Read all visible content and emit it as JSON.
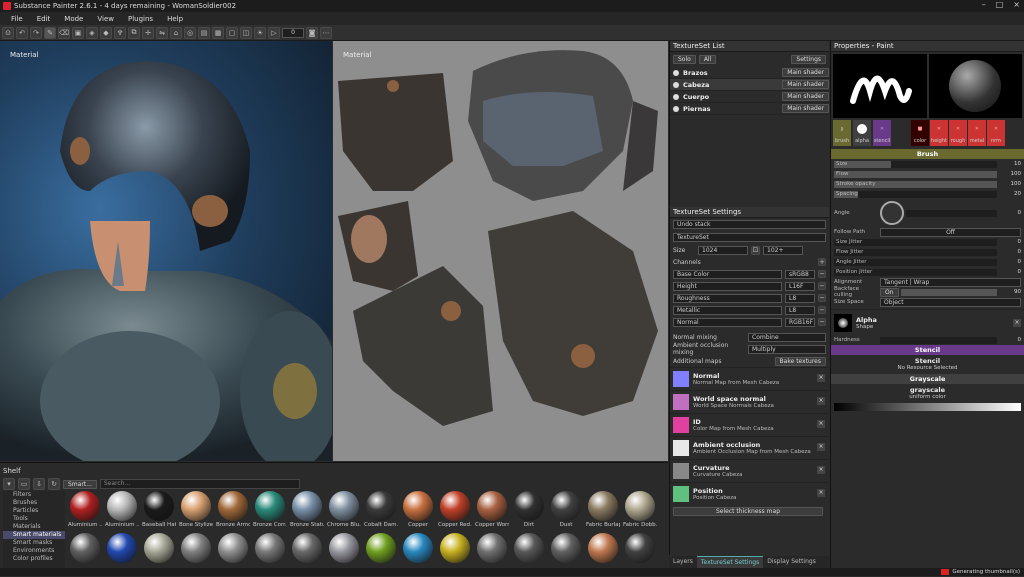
{
  "window": {
    "title": "Substance Painter 2.6.1 - 4 days remaining - WomanSoldier002"
  },
  "menu": [
    "File",
    "Edit",
    "Mode",
    "View",
    "Plugins",
    "Help"
  ],
  "toolbar": {
    "value": "0"
  },
  "viewport3d": {
    "label": "Material"
  },
  "viewport2d": {
    "label": "Material"
  },
  "shelf": {
    "title": "Shelf",
    "tab": "Smart...",
    "search_placeholder": "Search...",
    "categories": [
      "Filters",
      "Brushes",
      "Particles",
      "Tools",
      "Materials",
      "Smart materials",
      "Smart masks",
      "Environments",
      "Color profiles"
    ],
    "selected_category": "Smart materials",
    "materials_row1": [
      "Aluminium ...",
      "Aluminium ...",
      "Baseball Hat...",
      "Bone Stylized",
      "Bronze Armor",
      "Bronze Corr...",
      "Bronze Statue",
      "Chrome Blu...",
      "Cobalt Dam...",
      "Copper",
      "Copper Red...",
      "Copper Worn",
      "Dirt",
      "Dust",
      "Fabric Burlap",
      "Fabric Dobb..."
    ],
    "materials_row1_colors": [
      "#b02020",
      "#b8b8b8",
      "#1a1a1a",
      "#d8a070",
      "#a06838",
      "#2a8a7a",
      "#7890a8",
      "#8090a0",
      "#3a3a3a",
      "#c87040",
      "#c04028",
      "#a86040",
      "#303030",
      "#404040",
      "#8a7a60",
      "#b0a890"
    ],
    "materials_row2_colors": [
      "#606060",
      "#2048b0",
      "#a8a898",
      "#808080",
      "#909090",
      "#787878",
      "#686868",
      "#9898a0",
      "#70a020",
      "#2888c0",
      "#c8b020",
      "#707070",
      "#585858",
      "#606060",
      "#c07850",
      "#404040"
    ]
  },
  "textureset_list": {
    "title": "TextureSet List",
    "solo": "Solo",
    "all": "All",
    "settings": "Settings",
    "items": [
      {
        "name": "Brazos",
        "shader": "Main shader"
      },
      {
        "name": "Cabeza",
        "shader": "Main shader"
      },
      {
        "name": "Cuerpo",
        "shader": "Main shader"
      },
      {
        "name": "Piernas",
        "shader": "Main shader"
      }
    ]
  },
  "textureset_settings": {
    "title": "TextureSet Settings",
    "undo_stack": "Undo stack",
    "textureset": "TextureSet",
    "size_label": "Size",
    "size_value": "1024",
    "size_value2": "102+",
    "channels_label": "Channels",
    "channels": [
      {
        "name": "Base Color",
        "format": "sRGB8"
      },
      {
        "name": "Height",
        "format": "L16F"
      },
      {
        "name": "Roughness",
        "format": "L8"
      },
      {
        "name": "Metallic",
        "format": "L8"
      },
      {
        "name": "Normal",
        "format": "RGB16F"
      }
    ],
    "normal_mixing_label": "Normal mixing",
    "normal_mixing_value": "Combine",
    "ao_mixing_label": "Ambient occlusion mixing",
    "ao_mixing_value": "Multiply",
    "additional_maps": "Additional maps",
    "bake_textures": "Bake textures",
    "maps": [
      {
        "name": "Normal",
        "sub": "Normal Map from Mesh Cabeza",
        "color": "#8080ff"
      },
      {
        "name": "World space normal",
        "sub": "World Space Normals Cabeza",
        "color": "#c070c0"
      },
      {
        "name": "ID",
        "sub": "Color Map from Mesh Cabeza",
        "color": "#e040a0"
      },
      {
        "name": "Ambient occlusion",
        "sub": "Ambient Occlusion Map from Mesh Cabeza",
        "color": "#e8e8e8"
      },
      {
        "name": "Curvature",
        "sub": "Curvature Cabeza",
        "color": "#888888"
      },
      {
        "name": "Position",
        "sub": "Position Cabeza",
        "color": "#60c080"
      }
    ],
    "select_thickness": "Select thickness map"
  },
  "bottom_tabs": [
    "Layers",
    "TextureSet Settings",
    "Display Settings"
  ],
  "properties": {
    "title": "Properties - Paint",
    "slots": [
      "brush",
      "alpha",
      "stencil"
    ],
    "material_slots": [
      "color",
      "height",
      "rough",
      "metal",
      "nrm"
    ],
    "brush_section": "Brush",
    "rows": [
      {
        "label": "Size",
        "value": "10",
        "fill": 0.35
      },
      {
        "label": "Flow",
        "value": "100",
        "fill": 1.0
      },
      {
        "label": "Stroke opacity",
        "value": "100",
        "fill": 1.0
      },
      {
        "label": "Spacing",
        "value": "20",
        "fill": 0.15
      }
    ],
    "angle_label": "Angle",
    "angle_value": "0",
    "follow_path": "Follow Path",
    "follow_path_value": "Off",
    "jitters": [
      {
        "label": "Size Jitter",
        "value": "0"
      },
      {
        "label": "Flow Jitter",
        "value": "0"
      },
      {
        "label": "Angle Jitter",
        "value": "0"
      },
      {
        "label": "Position Jitter",
        "value": "0"
      }
    ],
    "alignment_label": "Alignment",
    "alignment_value": "Tangent | Wrap",
    "backface_label": "Backface culling",
    "backface_toggle": "On",
    "backface_value": "90",
    "size_space_label": "Size Space",
    "size_space_value": "Object",
    "alpha_title": "Alpha",
    "alpha_sub": "Shape",
    "hardness_label": "Hardness",
    "hardness_value": "0",
    "stencil_section": "Stencil",
    "stencil_title": "Stencil",
    "stencil_sub": "No Resource Selected",
    "grayscale_section": "Grayscale",
    "grayscale_title": "grayscale",
    "grayscale_sub": "uniform color"
  },
  "status": {
    "message": "Generating thumbnail(s)"
  }
}
